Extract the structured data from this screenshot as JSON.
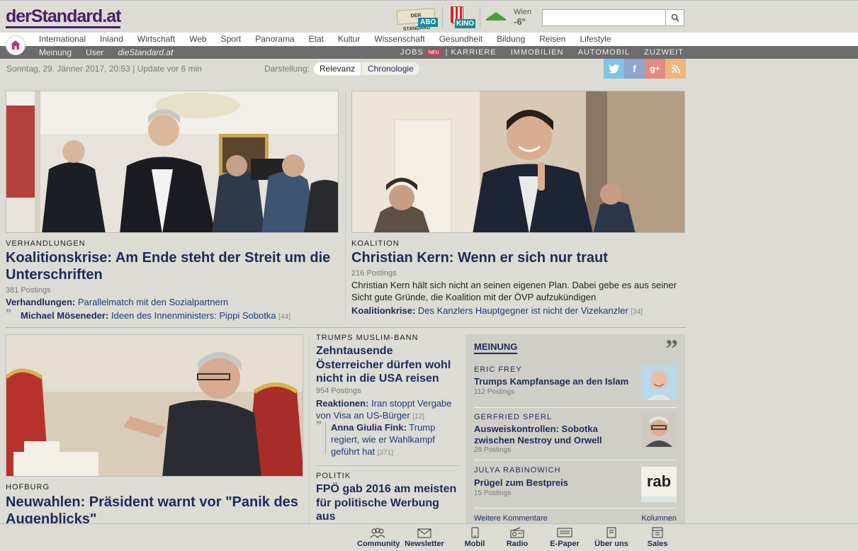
{
  "header": {
    "logo": "derStandard.at",
    "abo_paper": "DER STANDARD",
    "abo_label": "ABO",
    "kino_label": "KINO",
    "weather_city": "Wien",
    "weather_temp": "-6°",
    "search_placeholder": ""
  },
  "nav": {
    "primary": [
      "International",
      "Inland",
      "Wirtschaft",
      "Web",
      "Sport",
      "Panorama",
      "Etat",
      "Kultur",
      "Wissenschaft",
      "Gesundheit",
      "Bildung",
      "Reisen",
      "Lifestyle"
    ],
    "secondary": [
      "Meinung",
      "User",
      "dieStandard.at"
    ],
    "jobs": "JOBS",
    "neu": "NEU",
    "bar": "|",
    "right": [
      "KARRIERE",
      "IMMOBILIEN",
      "AUTOMOBIL",
      "ZUZWEIT"
    ]
  },
  "infobar": {
    "date": "Sonntag, 29. Jänner 2017, 20:53 | Update vor 6 min",
    "darstellung": "Darstellung:",
    "relevanz": "Relevanz",
    "chronologie": "Chronologie"
  },
  "social": {
    "twitter": "t",
    "facebook": "f",
    "gplus": "g+",
    "rss": "rss"
  },
  "articles": {
    "a1": {
      "kicker": "VERHANDLUNGEN",
      "headline": "Koalitionskrise: Am Ende steht der Streit um die Unterschriften",
      "postings": "381 Postings",
      "rel1_label": "Verhandlungen:",
      "rel1_text": " Parallelmatch mit den Sozialpartnern",
      "rel2_label": "Michael Möseneder:",
      "rel2_text": " Ideen des Innenministers: Pippi Sobotka",
      "rel2_count": "[44]"
    },
    "a2": {
      "kicker": "KOALITION",
      "headline": "Christian Kern: Wenn er sich nur traut",
      "postings": "216 Postings",
      "teaser": "Christian Kern hält sich nicht an seinen eigenen Plan. Dabei gebe es aus seiner Sicht gute Gründe, die Koalition mit der ÖVP aufzukündigen",
      "rel1_label": "Koalitionkrise:",
      "rel1_text": " Des Kanzlers Hauptgegner ist nicht der Vizekanzler",
      "rel1_count": "[34]"
    },
    "a3": {
      "kicker": "HOFBURG",
      "headline": "Neuwahlen: Präsident warnt vor \"Panik des Augenblicks\""
    },
    "a4": {
      "kicker": "TRUMPS MUSLIM-BANN",
      "headline": "Zehntausende Österreicher dürfen wohl nicht in die USA reisen",
      "postings": "954 Postings",
      "rel1_label": "Reaktionen:",
      "rel1_text": " Iran stoppt Vergabe von Visa an US-Bürger",
      "rel1_count": "[12]",
      "rel2_label": "Anna Giulia Fink:",
      "rel2_text": " Trump regiert, wie er Wahlkampf geführt hat",
      "rel2_count": "[371]"
    },
    "a5": {
      "kicker": "POLITIK",
      "headline": "FPÖ gab 2016 am meisten für politische Werbung aus"
    }
  },
  "meinung": {
    "title": "MEINUNG",
    "quote": "”",
    "items": [
      {
        "author": "ERIC FREY",
        "title": "Trumps Kampfansage an den Islam",
        "postings": "112 Postings"
      },
      {
        "author": "GERFRIED SPERL",
        "title": "Ausweiskontrollen: Sobotka zwischen Nestroy und Orwell",
        "postings": "28 Postings"
      },
      {
        "author": "JULYA RABINOWICH",
        "title": "Prügel zum Bestpreis",
        "postings": "15 Postings",
        "logo": "rab"
      }
    ],
    "more": "Weitere Kommentare",
    "kolumnen": "Kolumnen"
  },
  "footer": [
    "Community",
    "Newsletter",
    "Mobil",
    "Radio",
    "E-Paper",
    "Über uns",
    "Sales"
  ],
  "colors": {
    "brand": "#4b1d67",
    "headline": "#1e2a5a",
    "background": "#dcdcd5"
  }
}
